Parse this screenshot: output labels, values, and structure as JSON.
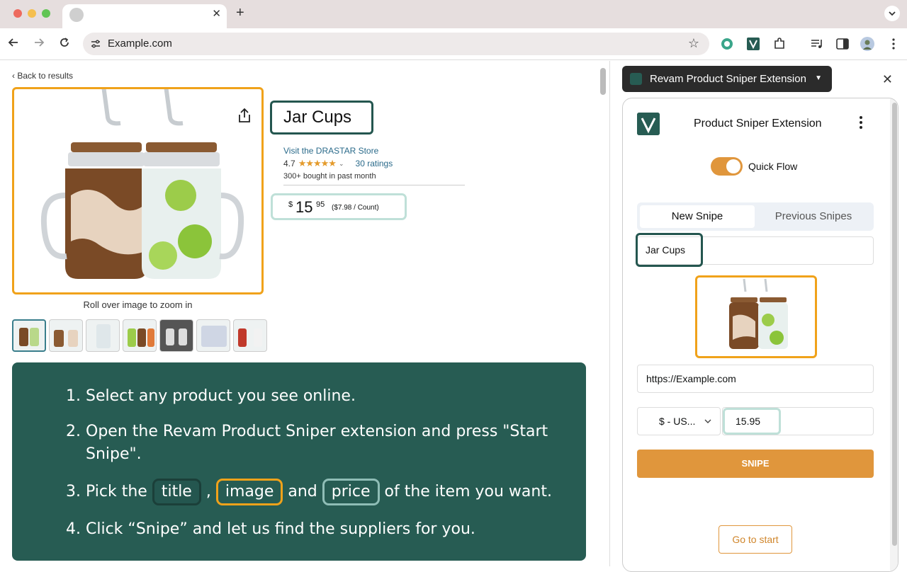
{
  "browser": {
    "url": "Example.com",
    "tab_close": "✕",
    "new_tab": "+"
  },
  "page": {
    "back_link": "Back to results",
    "title": "Jar Cups",
    "store_link": "Visit the DRASTAR Store",
    "rating": "4.7",
    "stars": "★★★★★",
    "ratings_count": "30 ratings",
    "bought": "300+ bought in past month",
    "price": {
      "currency": "$",
      "whole": "15",
      "fraction": "95",
      "unit": "($7.98 / Count)"
    },
    "zoom_hint": "Roll over image to zoom in",
    "thumbnail_count": 7
  },
  "instructions": {
    "step1": "Select any product you see online.",
    "step2": "Open the Revam Product Sniper extension and press \"Start Snipe\".",
    "step3_pre": "Pick the ",
    "step3_title": "title",
    "step3_sep": " , ",
    "step3_image": "image",
    "step3_and": " and ",
    "step3_price": "price",
    "step3_post": " of the item you want.",
    "step4": "Click “Snipe” and let us find the suppliers for you."
  },
  "sidepanel": {
    "extension_name": "Revam Product Sniper Extension",
    "heading": "Product Sniper Extension",
    "quick_flow_label": "Quick Flow",
    "quick_flow_on": true,
    "tabs": [
      "New Snipe",
      "Previous Snipes"
    ],
    "name_value": "Jar Cups",
    "url_value": "https://Example.com",
    "currency_value": "$ - US...",
    "price_value": "15.95",
    "snipe_label": "SNIPE",
    "go_to_start_label": "Go to start"
  },
  "colors": {
    "accent_orange": "#e0963c",
    "brand_green": "#275c53",
    "title_border": "#24564f",
    "image_border": "#f0a21a",
    "price_border": "#bfe0d8"
  }
}
